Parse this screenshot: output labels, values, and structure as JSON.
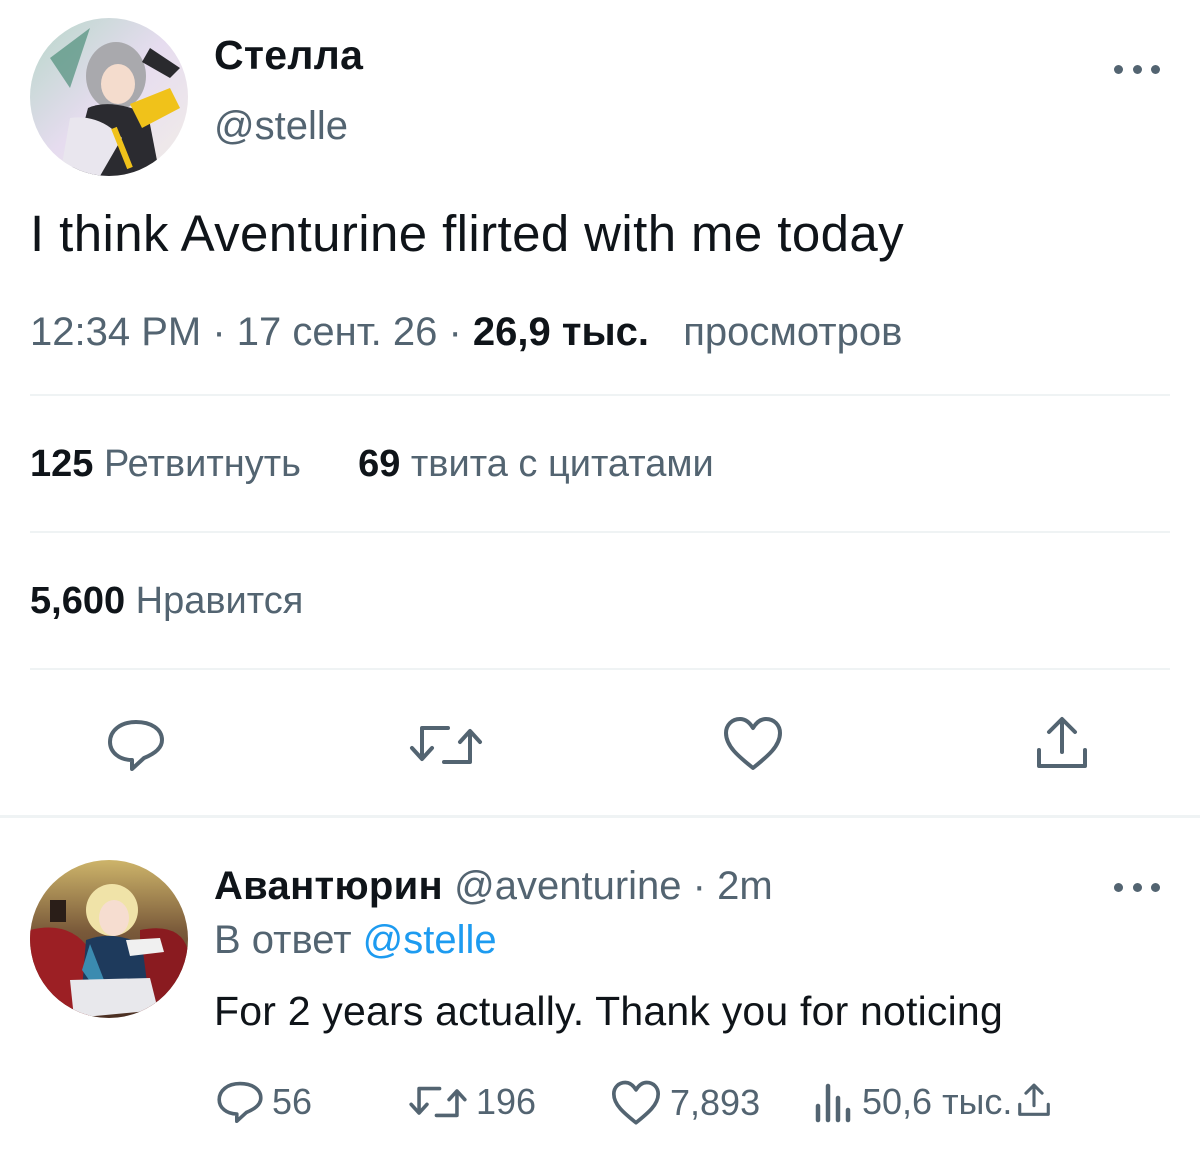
{
  "tweet": {
    "author_name": "Стелла",
    "author_handle": "@stelle",
    "text": "I think Aventurine flirted with me today",
    "time": "12:34 PM",
    "date": "17 сент. 26",
    "separator": "·",
    "views_count": "26,9 тыс.",
    "views_label": "просмотров",
    "retweets_count": "125",
    "retweets_label": "Ретвитнуть",
    "quotes_count": "69",
    "quotes_label": "твита с цитатами",
    "likes_count": "5,600",
    "likes_label": "Нравится",
    "icons": {
      "reply": "reply-icon",
      "retweet": "retweet-icon",
      "like": "heart-icon",
      "share": "share-icon",
      "more": "more-icon"
    }
  },
  "reply": {
    "author_name": "Авантюрин",
    "author_handle": "@aventurine",
    "separator": "·",
    "time_ago": "2m",
    "reply_prefix": "В ответ",
    "reply_mention": "@stelle",
    "text": "For 2 years actually. Thank you for noticing",
    "reply_count": "56",
    "retweet_count": "196",
    "like_count": "7,893",
    "views_count": "50,6 тыс."
  },
  "colors": {
    "text_primary": "#0f1419",
    "text_secondary": "#536471",
    "link": "#1d9bf0",
    "divider": "#eff3f4"
  }
}
